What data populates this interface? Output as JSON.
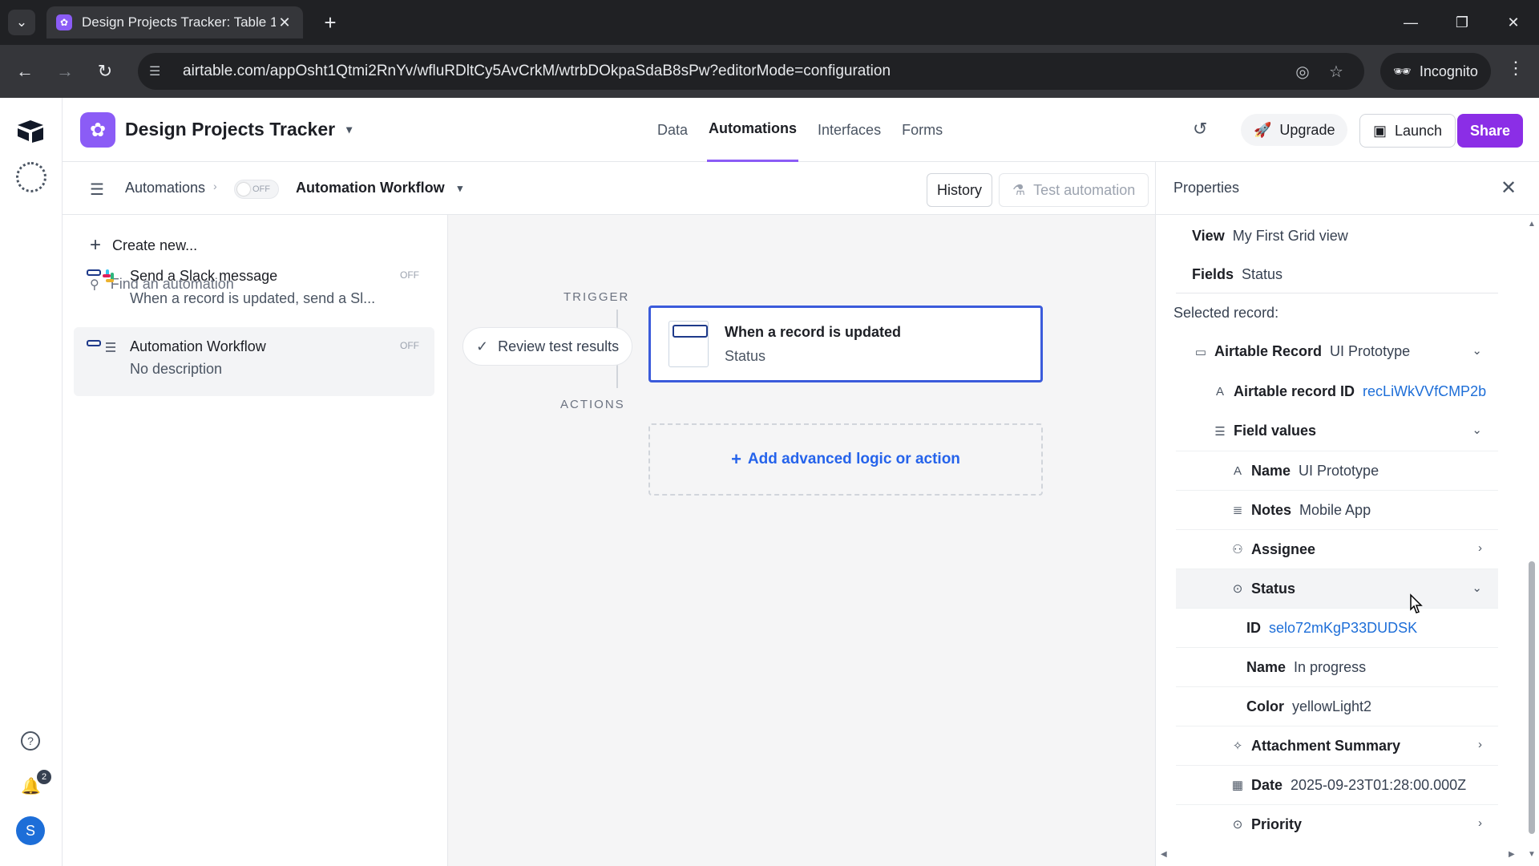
{
  "browser": {
    "tab_title": "Design Projects Tracker: Table 1",
    "url": "airtable.com/appOsht1Qtmi2RnYv/wfluRDltCy5AvCrkM/wtrbDOkpaSdaB8sPw?editorMode=configuration",
    "incognito_label": "Incognito"
  },
  "header": {
    "base_title": "Design Projects Tracker",
    "nav": [
      "Data",
      "Automations",
      "Interfaces",
      "Forms"
    ],
    "active_nav": "Automations",
    "upgrade": "Upgrade",
    "launch": "Launch",
    "share": "Share",
    "accent_color": "#8b2ee6"
  },
  "rail": {
    "notification_count": "2",
    "avatar_initial": "S"
  },
  "subheader": {
    "crumb": "Automations",
    "toggle_label": "OFF",
    "workflow_name": "Automation Workflow",
    "history": "History",
    "test": "Test automation"
  },
  "list": {
    "create_new": "Create new...",
    "search_placeholder": "Find an automation",
    "items": [
      {
        "title": "Send a Slack message",
        "desc": "When a record is updated, send a Sl...",
        "state": "OFF"
      },
      {
        "title": "Automation Workflow",
        "desc": "No description",
        "state": "OFF"
      }
    ]
  },
  "canvas": {
    "trigger_label": "TRIGGER",
    "actions_label": "ACTIONS",
    "review": "Review test results",
    "trigger_title": "When a record is updated",
    "trigger_sub": "Status",
    "add_action": "Add advanced logic or action"
  },
  "properties": {
    "title": "Properties",
    "view_key": "View",
    "view_val": "My First Grid view",
    "fields_key": "Fields",
    "fields_val": "Status",
    "selected_record": "Selected record:",
    "record_key": "Airtable Record",
    "record_val": "UI Prototype",
    "record_id_key": "Airtable record ID",
    "record_id_val": "recLiWkVVfCMP2b",
    "field_values": "Field values",
    "name_key": "Name",
    "name_val": "UI Prototype",
    "notes_key": "Notes",
    "notes_val": "Mobile App",
    "assignee_key": "Assignee",
    "status_key": "Status",
    "status_id_key": "ID",
    "status_id_val": "selo72mKgP33DUDSK",
    "status_name_key": "Name",
    "status_name_val": "In progress",
    "status_color_key": "Color",
    "status_color_val": "yellowLight2",
    "attachment_key": "Attachment Summary",
    "date_key": "Date",
    "date_val": "2025-09-23T01:28:00.000Z",
    "priority_key": "Priority"
  }
}
